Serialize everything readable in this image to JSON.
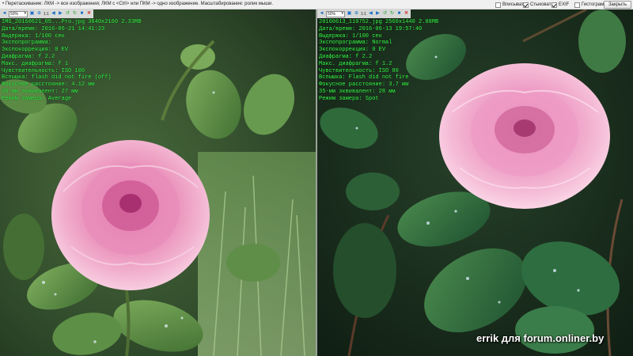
{
  "hint_text": "• Перетаскивание: ЛКМ -> все изображения; ЛКМ с <Ctrl> или ПКМ -> одно изображение. Масштабирование: ролик мыши.",
  "options": [
    {
      "label": "Вписывать",
      "checked": false
    },
    {
      "label": "Стыковать",
      "checked": true
    },
    {
      "label": "EXIF",
      "checked": true
    },
    {
      "label": "Гистограмма",
      "checked": false
    }
  ],
  "close_label": "Закрыть",
  "panes": [
    {
      "zoom": "50%",
      "page_label": "1:1",
      "exif_lines": [
        "IMG_20160621_05...Pro.jpg    3840x2160    2.33MB",
        "Дата/время: 2016-06-21 14:41:23",
        "Выдержка: 1/100 сек",
        "Экспопрограмма: ",
        "Экспокоррекция: 0 EV",
        "Диафрагма: f 2.2",
        "Макс. диафрагма: f 1",
        "Чувствительность: ISO 100",
        "Вспышка: flash did not fire (off)",
        "Фокусное расстояние: 4.12 мм",
        "35-мм эквивалент: 27 мм",
        "Режим замера: Average"
      ]
    },
    {
      "zoom": "50%",
      "page_label": "1:1",
      "exif_lines": [
        "20160613_110752.jpg    2560x1440    2.08MB",
        "Дата/время: 2016-06-13 19:57:40",
        "Выдержка: 1/100 сек",
        "Экспопрограмма: Normal",
        "Экспокоррекция: 0 EV",
        "Диафрагма: f 2.2",
        "Макс. диафрагма: f 1.2",
        "Чувствительность: ISO 80",
        "Вспышка: Flash did not fire",
        "Фокусное расстояние: 3.7 мм",
        "35-мм эквивалент: 28 мм",
        "Режим замера: Spot"
      ]
    }
  ],
  "watermark": "errik для forum.onliner.by",
  "icons": {
    "zoom_in": "zoom-in-icon",
    "zoom_out": "zoom-out-icon",
    "fit": "fit-icon",
    "actual": "actual-size-icon",
    "prev": "prev-icon",
    "next": "next-icon",
    "rotate_left": "rotate-left-icon",
    "rotate_right": "rotate-right-icon",
    "save": "save-icon",
    "close": "close-x-icon"
  },
  "colors": {
    "exif_text": "#38ff4a",
    "toolbar_icon": "#1c6dc8",
    "close_icon": "#dd2222"
  }
}
